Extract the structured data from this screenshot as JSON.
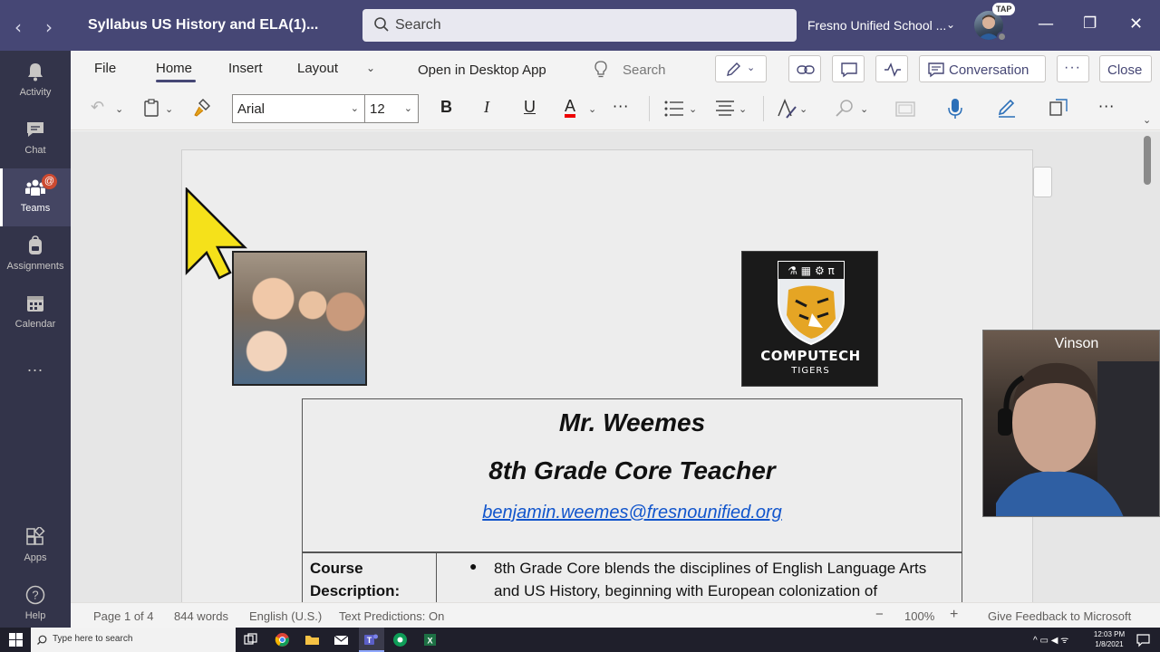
{
  "titlebar": {
    "back": "‹",
    "forward": "›",
    "doc_title": "Syllabus US History and ELA(1)...",
    "search_placeholder": "Search",
    "org": "Fresno Unified School ...",
    "avatar_badge": "TAP"
  },
  "rail": {
    "items": [
      {
        "label": "Activity"
      },
      {
        "label": "Chat"
      },
      {
        "label": "Teams",
        "badge": "@"
      },
      {
        "label": "Assignments"
      },
      {
        "label": "Calendar"
      },
      {
        "label": "..."
      },
      {
        "label": "Apps"
      },
      {
        "label": "Help"
      }
    ]
  },
  "ribbon": {
    "tabs": [
      "File",
      "Home",
      "Insert",
      "Layout"
    ],
    "open_desktop": "Open in Desktop App",
    "search": "Search",
    "conversation": "Conversation",
    "close": "Close",
    "font_name": "Arial",
    "font_size": "12",
    "bold": "B",
    "italic": "I",
    "underline": "U",
    "font_color": "A",
    "more": "···"
  },
  "document": {
    "name": "Mr. Weemes",
    "role": "8th Grade Core Teacher",
    "email": "benjamin.weemes@fresnounified.org",
    "logo_title": "COMPUTECH",
    "logo_sub": "TIGERS",
    "course_label": "Course Description:",
    "course_text": "8th Grade Core blends the disciplines of English Language Arts and US History, beginning with European colonization of"
  },
  "video": {
    "name": "Vinson"
  },
  "statusbar": {
    "page": "Page 1 of 4",
    "words": "844 words",
    "language": "English (U.S.)",
    "predictions": "Text Predictions: On",
    "zoom_out": "−",
    "zoom": "100%",
    "zoom_in": "+",
    "feedback": "Give Feedback to Microsoft"
  },
  "taskbar": {
    "search_placeholder": "Type here to search",
    "time": "12:03 PM",
    "date": "1/8/2021"
  },
  "colors": {
    "teams_purple": "#464775",
    "rail": "#33344a",
    "link": "#1155cc",
    "badge": "#cc4a31"
  }
}
